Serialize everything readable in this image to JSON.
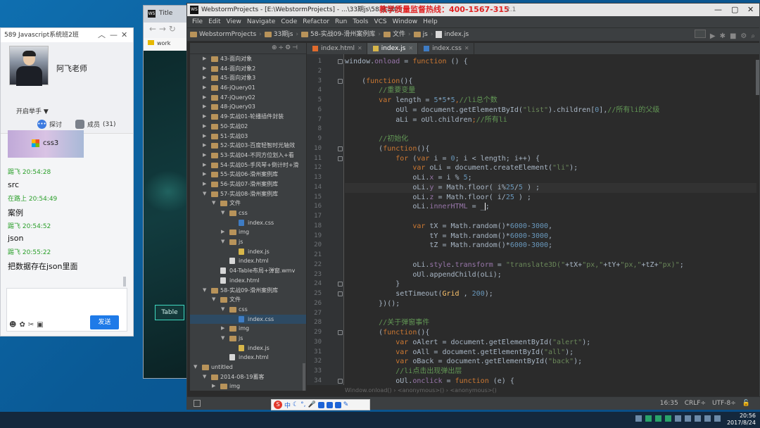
{
  "chat": {
    "title": "589 Javascript系统班2班",
    "teacher": "阿飞老师",
    "hand_raise": "开启举手 ▼",
    "tab_discuss": "探讨",
    "tab_members": "成员",
    "member_count": "(31)",
    "image_caption": "css3",
    "messages": [
      {
        "meta": "踢飞  20:54:28",
        "text": "src"
      },
      {
        "meta": "在路上  20:54:49",
        "text": "案例"
      },
      {
        "meta": "踢飞  20:54:52",
        "text": "json"
      },
      {
        "meta": "踢飞  20:55:22",
        "text": "把数据存在json里面"
      }
    ],
    "send_label": "发送"
  },
  "browser": {
    "tab_title": "Title",
    "bookmark": "work",
    "table_button": "Table"
  },
  "ide": {
    "title": "WebstormProjects - [E:\\WebstormProjects] - ...\\33期js\\58-实战09",
    "hotline": "教学质量监督热线：400-1567-315",
    "version": "2.1",
    "menu": [
      "File",
      "Edit",
      "View",
      "Navigate",
      "Code",
      "Refactor",
      "Run",
      "Tools",
      "VCS",
      "Window",
      "Help"
    ],
    "breadcrumb": [
      "WebstormProjects",
      "33期js",
      "58-实战09-滑州案例库",
      "文件",
      "js",
      "index.js"
    ],
    "tabs": [
      {
        "label": "index.html",
        "kind": "html",
        "active": false
      },
      {
        "label": "index.js",
        "kind": "js",
        "active": true
      },
      {
        "label": "index.css",
        "kind": "css",
        "active": false
      }
    ],
    "status_position": "16:35",
    "status_lineend": "CRLF÷",
    "status_encoding": "UTF-8÷",
    "code_breadcrumb": "Window.onload()  ›  <anonymous>()  ›  <anonymous>()"
  },
  "project_tree": [
    {
      "label": "43-面向对象",
      "depth": 0,
      "type": "folder",
      "arrow": "▶"
    },
    {
      "label": "44-面向对象2",
      "depth": 0,
      "type": "folder",
      "arrow": "▶"
    },
    {
      "label": "45-面向对象3",
      "depth": 0,
      "type": "folder",
      "arrow": "▶"
    },
    {
      "label": "46-jQuery01",
      "depth": 0,
      "type": "folder",
      "arrow": "▶"
    },
    {
      "label": "47-jQuery02",
      "depth": 0,
      "type": "folder",
      "arrow": "▶"
    },
    {
      "label": "48-jQuery03",
      "depth": 0,
      "type": "folder",
      "arrow": "▶"
    },
    {
      "label": "49-实战01-轮播插件封装",
      "depth": 0,
      "type": "folder",
      "arrow": "▶"
    },
    {
      "label": "50-实战02",
      "depth": 0,
      "type": "folder",
      "arrow": "▶"
    },
    {
      "label": "51-实战03",
      "depth": 0,
      "type": "folder",
      "arrow": "▶"
    },
    {
      "label": "52-实战03-百度轻智时光轴效",
      "depth": 0,
      "type": "folder",
      "arrow": "▶"
    },
    {
      "label": "53-实战04-不同方位划入+看",
      "depth": 0,
      "type": "folder",
      "arrow": "▶"
    },
    {
      "label": "54-实战05-手风琴+倒计时+滑",
      "depth": 0,
      "type": "folder",
      "arrow": "▶"
    },
    {
      "label": "55-实战06-滑州案例库",
      "depth": 0,
      "type": "folder",
      "arrow": "▶"
    },
    {
      "label": "56-实战07-滑州案例库",
      "depth": 0,
      "type": "folder",
      "arrow": "▶"
    },
    {
      "label": "57-实战08-滑州案例库",
      "depth": 0,
      "type": "folder",
      "arrow": "▼"
    },
    {
      "label": "文件",
      "depth": 1,
      "type": "folder",
      "arrow": "▼"
    },
    {
      "label": "css",
      "depth": 2,
      "type": "folder",
      "arrow": "▼"
    },
    {
      "label": "index.css",
      "depth": 3,
      "type": "css",
      "arrow": ""
    },
    {
      "label": "img",
      "depth": 2,
      "type": "folder",
      "arrow": "▶"
    },
    {
      "label": "js",
      "depth": 2,
      "type": "folder",
      "arrow": "▼"
    },
    {
      "label": "index.js",
      "depth": 3,
      "type": "js",
      "arrow": ""
    },
    {
      "label": "index.html",
      "depth": 2,
      "type": "file",
      "arrow": ""
    },
    {
      "label": "04-Table布局+弹窗.wmv",
      "depth": 1,
      "type": "file",
      "arrow": ""
    },
    {
      "label": "index.html",
      "depth": 1,
      "type": "file",
      "arrow": ""
    },
    {
      "label": "58-实战09-滑州案例库",
      "depth": 0,
      "type": "folder",
      "arrow": "▼"
    },
    {
      "label": "文件",
      "depth": 1,
      "type": "folder",
      "arrow": "▼"
    },
    {
      "label": "css",
      "depth": 2,
      "type": "folder",
      "arrow": "▼"
    },
    {
      "label": "index.css",
      "depth": 3,
      "type": "css",
      "arrow": "",
      "selected": true
    },
    {
      "label": "img",
      "depth": 2,
      "type": "folder",
      "arrow": "▶"
    },
    {
      "label": "js",
      "depth": 2,
      "type": "folder",
      "arrow": "▼"
    },
    {
      "label": "index.js",
      "depth": 3,
      "type": "js",
      "arrow": ""
    },
    {
      "label": "index.html",
      "depth": 2,
      "type": "file",
      "arrow": ""
    },
    {
      "label": "untitled",
      "depth": -1,
      "type": "folder",
      "arrow": "▼"
    },
    {
      "label": "2014-08-19蓄客",
      "depth": 0,
      "type": "folder",
      "arrow": "▼"
    },
    {
      "label": "img",
      "depth": 1,
      "type": "folder",
      "arrow": "▶"
    },
    {
      "label": "index.html",
      "depth": 1,
      "type": "file",
      "arrow": ""
    }
  ],
  "code": [
    [
      [
        "window",
        "pl"
      ],
      [
        ".",
        "pl"
      ],
      [
        "onload",
        "prop"
      ],
      [
        " = ",
        "pl"
      ],
      [
        "function",
        "kw"
      ],
      [
        " () {",
        "pl"
      ]
    ],
    [],
    [
      [
        "    (",
        "pl"
      ],
      [
        "function",
        "kw"
      ],
      [
        "(){",
        "pl"
      ]
    ],
    [
      [
        "        //重要变量",
        "cm"
      ]
    ],
    [
      [
        "        ",
        "pl"
      ],
      [
        "var",
        "kw"
      ],
      [
        " length = ",
        "pl"
      ],
      [
        "5",
        "num"
      ],
      [
        "*",
        "pl"
      ],
      [
        "5",
        "num"
      ],
      [
        "*",
        "pl"
      ],
      [
        "5",
        "num"
      ],
      [
        ",",
        "kw"
      ],
      [
        "//li总个数",
        "cm"
      ]
    ],
    [
      [
        "            oUl = document.",
        "pl"
      ],
      [
        "getElementById",
        "pl"
      ],
      [
        "(",
        "pl"
      ],
      [
        "\"list\"",
        "str"
      ],
      [
        ").",
        "pl"
      ],
      [
        "children",
        "pl"
      ],
      [
        "[",
        "pl"
      ],
      [
        "0",
        "num"
      ],
      [
        "],",
        "pl"
      ],
      [
        "//所有li的父级",
        "cm"
      ]
    ],
    [
      [
        "            aLi = oUl.",
        "pl"
      ],
      [
        "children",
        "pl"
      ],
      [
        ";",
        "kw"
      ],
      [
        "//所有li",
        "cm"
      ]
    ],
    [],
    [
      [
        "        //初始化",
        "cm"
      ]
    ],
    [
      [
        "        (",
        "pl"
      ],
      [
        "function",
        "kw"
      ],
      [
        "(){",
        "pl"
      ]
    ],
    [
      [
        "            ",
        "pl"
      ],
      [
        "for",
        "kw"
      ],
      [
        " (",
        "pl"
      ],
      [
        "var",
        "kw"
      ],
      [
        " i = ",
        "pl"
      ],
      [
        "0",
        "num"
      ],
      [
        "; i < length; i++) {",
        "pl"
      ]
    ],
    [
      [
        "                ",
        "pl"
      ],
      [
        "var",
        "kw"
      ],
      [
        " oLi = document.",
        "pl"
      ],
      [
        "createElement",
        "pl"
      ],
      [
        "(",
        "pl"
      ],
      [
        "\"li\"",
        "str"
      ],
      [
        ");",
        "pl"
      ]
    ],
    [
      [
        "                oLi.",
        "pl"
      ],
      [
        "x",
        "prop"
      ],
      [
        " = i % ",
        "pl"
      ],
      [
        "5",
        "num"
      ],
      [
        ";",
        "pl"
      ]
    ],
    [
      [
        "                oLi.",
        "pl"
      ],
      [
        "y",
        "prop"
      ],
      [
        " = Math.",
        "pl"
      ],
      [
        "floor",
        "pl"
      ],
      [
        "( i%",
        "pl"
      ],
      [
        "25",
        "num"
      ],
      [
        "/",
        "pl"
      ],
      [
        "5",
        "num"
      ],
      [
        " ) ;",
        "pl"
      ]
    ],
    [
      [
        "                oLi.",
        "pl"
      ],
      [
        "z",
        "prop"
      ],
      [
        " = Math.",
        "pl"
      ],
      [
        "floor",
        "pl"
      ],
      [
        "( i/",
        "pl"
      ],
      [
        "25",
        "num"
      ],
      [
        " ) ;",
        "pl"
      ]
    ],
    [
      [
        "                oLi.",
        "pl"
      ],
      [
        "innerHTML",
        "prop"
      ],
      [
        " = _",
        "pl"
      ],
      [
        "CARET",
        "caret"
      ],
      [
        ";",
        "pl"
      ]
    ],
    [],
    [
      [
        "                ",
        "pl"
      ],
      [
        "var",
        "kw"
      ],
      [
        " tX = Math.",
        "pl"
      ],
      [
        "random",
        "pl"
      ],
      [
        "()*",
        "pl"
      ],
      [
        "6000",
        "num"
      ],
      [
        "-",
        "pl"
      ],
      [
        "3000",
        "num"
      ],
      [
        ",",
        "pl"
      ]
    ],
    [
      [
        "                    tY = Math.",
        "pl"
      ],
      [
        "random",
        "pl"
      ],
      [
        "()*",
        "pl"
      ],
      [
        "6000",
        "num"
      ],
      [
        "-",
        "pl"
      ],
      [
        "3000",
        "num"
      ],
      [
        ",",
        "pl"
      ]
    ],
    [
      [
        "                    tZ = Math.",
        "pl"
      ],
      [
        "random",
        "pl"
      ],
      [
        "()*",
        "pl"
      ],
      [
        "6000",
        "num"
      ],
      [
        "-",
        "pl"
      ],
      [
        "3000",
        "num"
      ],
      [
        ";",
        "pl"
      ]
    ],
    [],
    [
      [
        "                oLi.",
        "pl"
      ],
      [
        "style",
        "prop"
      ],
      [
        ".",
        "pl"
      ],
      [
        "transform",
        "prop"
      ],
      [
        " = ",
        "pl"
      ],
      [
        "\"translate3D(\"",
        "str"
      ],
      [
        "+tX+",
        "pl"
      ],
      [
        "\"px,\"",
        "str"
      ],
      [
        "+tY+",
        "pl"
      ],
      [
        "\"px,\"",
        "str"
      ],
      [
        "+tZ+",
        "pl"
      ],
      [
        "\"px)\"",
        "str"
      ],
      [
        ";",
        "pl"
      ]
    ],
    [
      [
        "                oUl.",
        "pl"
      ],
      [
        "appendChild",
        "pl"
      ],
      [
        "(oLi);",
        "pl"
      ]
    ],
    [
      [
        "            }",
        "pl"
      ]
    ],
    [
      [
        "            ",
        "pl"
      ],
      [
        "setTimeout",
        "pl"
      ],
      [
        "(",
        "pl"
      ],
      [
        "Grid",
        "fn"
      ],
      [
        " , ",
        "pl"
      ],
      [
        "200",
        "num"
      ],
      [
        ");",
        "pl"
      ]
    ],
    [
      [
        "        })();",
        "pl"
      ]
    ],
    [],
    [
      [
        "        //关于弹窗事件",
        "cm"
      ]
    ],
    [
      [
        "        (",
        "pl"
      ],
      [
        "function",
        "kw"
      ],
      [
        "(){",
        "pl"
      ]
    ],
    [
      [
        "            ",
        "pl"
      ],
      [
        "var",
        "kw"
      ],
      [
        " oAlert = document.",
        "pl"
      ],
      [
        "getElementById",
        "pl"
      ],
      [
        "(",
        "pl"
      ],
      [
        "\"alert\"",
        "str"
      ],
      [
        ");",
        "pl"
      ]
    ],
    [
      [
        "            ",
        "pl"
      ],
      [
        "var",
        "kw"
      ],
      [
        " oAll = document.",
        "pl"
      ],
      [
        "getElementById",
        "pl"
      ],
      [
        "(",
        "pl"
      ],
      [
        "\"all\"",
        "str"
      ],
      [
        ");",
        "pl"
      ]
    ],
    [
      [
        "            ",
        "pl"
      ],
      [
        "var",
        "kw"
      ],
      [
        " oBack = document.",
        "pl"
      ],
      [
        "getElementById",
        "pl"
      ],
      [
        "(",
        "pl"
      ],
      [
        "\"back\"",
        "str"
      ],
      [
        ");",
        "pl"
      ]
    ],
    [
      [
        "            //li点击出现弹出层",
        "cm"
      ]
    ],
    [
      [
        "            oUl.",
        "pl"
      ],
      [
        "onclick",
        "prop"
      ],
      [
        " = ",
        "pl"
      ],
      [
        "function",
        "kw"
      ],
      [
        " (e) {",
        "pl"
      ]
    ]
  ],
  "current_line": 14,
  "fold_lines": [
    1,
    3,
    10,
    11,
    24,
    25,
    29,
    34
  ],
  "taskbar": {
    "time": "20:56",
    "date": "2017/8/24"
  }
}
